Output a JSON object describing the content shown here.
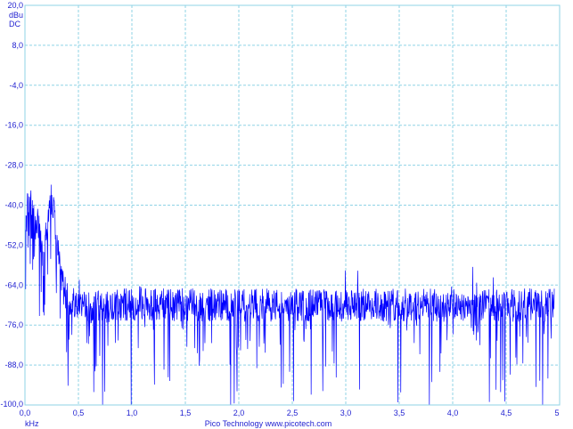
{
  "window": {
    "footer_text": "Pico Technology   www.picotech.com"
  },
  "chart_data": {
    "type": "line",
    "title": "",
    "ylabel_unit": "dBu",
    "ylabel_coupling": "DC",
    "xlabel": "kHz",
    "xlim": [
      0,
      5
    ],
    "ylim": [
      -100,
      20
    ],
    "x_ticks": [
      "0,0",
      "0,5",
      "1,0",
      "1,5",
      "2,0",
      "2,5",
      "3,0",
      "3,5",
      "4,0",
      "4,5",
      "5"
    ],
    "y_ticks": [
      "20,0",
      "8,0",
      "-4,0",
      "-16,0",
      "-28,0",
      "-40,0",
      "-52,0",
      "-64,0",
      "-76,0",
      "-88,0",
      "-100,0"
    ],
    "grid": true,
    "colors": {
      "trace": "#0000ff",
      "grid": "#8fd3e6",
      "text": "#1f1fd0"
    },
    "series": [
      {
        "x": [
          0.0,
          0.02,
          0.04,
          0.06,
          0.08,
          0.1,
          0.12,
          0.14,
          0.16,
          0.18,
          0.2,
          0.22,
          0.24,
          0.26,
          0.28,
          0.3,
          0.32,
          0.34,
          0.36,
          0.38,
          0.4,
          0.45,
          0.5,
          0.6,
          0.7,
          0.8,
          0.9,
          1.0,
          1.1,
          1.2,
          1.3,
          1.4,
          1.5,
          1.75,
          2.0,
          2.25,
          2.5,
          2.75,
          3.0,
          3.25,
          3.5,
          3.75,
          4.0,
          4.25,
          4.5,
          4.75,
          4.95
        ],
        "values": [
          -50,
          -42,
          -36,
          -40,
          -44,
          -48,
          -45,
          -50,
          -54,
          -52,
          -47,
          -42,
          -38,
          -40,
          -45,
          -52,
          -57,
          -62,
          -65,
          -66,
          -68,
          -69,
          -70,
          -71,
          -70,
          -71,
          -70,
          -70,
          -69,
          -70,
          -70,
          -70,
          -70,
          -70,
          -70,
          -70,
          -70,
          -70,
          -70,
          -70,
          -70,
          -70,
          -70,
          -70,
          -70,
          -70,
          -70
        ]
      }
    ]
  }
}
